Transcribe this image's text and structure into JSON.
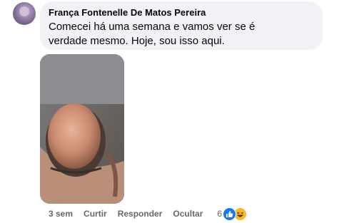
{
  "comment": {
    "author": "França Fontenelle De Matos Pereira",
    "text": "Comecei há uma semana e vamos ver se é verdade mesmo. Hoje, sou isso aqui."
  },
  "actions": {
    "time": "3 sem",
    "like": "Curtir",
    "reply": "Responder",
    "hide": "Ocultar",
    "reaction_count": "6",
    "reaction_icons": [
      "like-icon",
      "haha-icon"
    ]
  },
  "colors": {
    "bubble": "#f0f2f5",
    "meta_text": "#65676b",
    "like_blue": "#1877f2",
    "haha_yellow": "#f7b928"
  }
}
